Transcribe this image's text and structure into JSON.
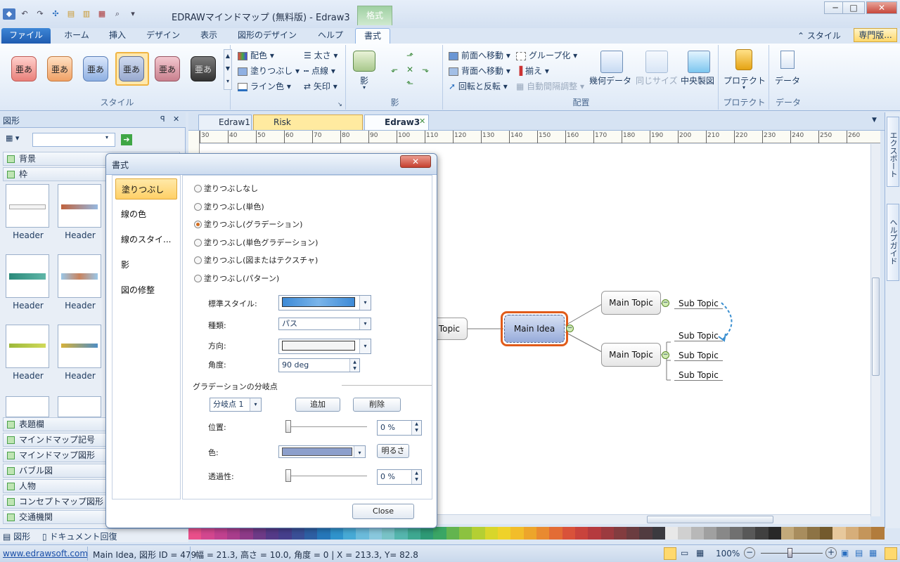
{
  "window": {
    "title": "EDRAWマインドマップ (無料版) - Edraw3",
    "context_tab": "格式",
    "min": "─",
    "max": "□",
    "close": "✕"
  },
  "tabs": [
    "ファイル",
    "ホーム",
    "挿入",
    "デザイン",
    "表示",
    "図形のデザイン",
    "ヘルプ",
    "書式"
  ],
  "ribbon_right": {
    "style": "スタイル",
    "pro": "専門版..."
  },
  "ribbon": {
    "style_swatch": "亜あ",
    "style_group": "スタイル",
    "color_scheme": "配色",
    "fill": "塗りつぶし",
    "line_color": "ライン色",
    "thickness": "太さ",
    "dotted": "点線",
    "arrow": "矢印",
    "shadow_btn": "影",
    "shadow_group": "影",
    "bring_front": "前面へ移動",
    "send_back": "背面へ移動",
    "rotate_flip": "回転と反転",
    "group": "グループ化",
    "align": "揃え",
    "auto_space": "自動間隔調整",
    "geometry": "幾何データ",
    "same_size": "同じサイズ",
    "center": "中央製図",
    "arrange_group": "配置",
    "protect": "プロテクト",
    "protect_group": "プロテクト",
    "data": "データ",
    "data_group": "データ"
  },
  "shapes_panel": {
    "title": "図形",
    "pin": "ꟼ",
    "close": "✕",
    "categories_top": [
      "背景",
      "枠"
    ],
    "thumb_label": "Header",
    "categories_bottom": [
      "表題欄",
      "マインドマップ記号",
      "マインドマップ図形",
      "バブル図",
      "人物",
      "コンセプトマップ図形",
      "交通機関"
    ],
    "bottom_tabs": [
      "図形",
      "ドキュメント回復"
    ]
  },
  "doc_tabs": [
    "Edraw1",
    "Risk Management.edx",
    "Edraw3"
  ],
  "ruler_ticks": [
    "30",
    "40",
    "50",
    "60",
    "70",
    "80",
    "90",
    "100",
    "110",
    "120",
    "130",
    "140",
    "150",
    "160",
    "170",
    "180",
    "190",
    "200",
    "210",
    "220",
    "230",
    "240",
    "250",
    "260"
  ],
  "mindmap": {
    "main_idea": "Main Idea",
    "left_topic": "Topic",
    "topic1": "Main Topic",
    "topic2": "Main Topic",
    "sub1": "Sub Topic",
    "sub2": "Sub Topic",
    "sub3": "Sub Topic",
    "sub4": "Sub Topic"
  },
  "right_tabs": [
    "エクスポート",
    "ヘルプガイド"
  ],
  "dialog": {
    "title": "書式",
    "close": "✕",
    "nav": [
      "塗りつぶし",
      "線の色",
      "線のスタイ...",
      "影",
      "図の修整"
    ],
    "radios": [
      "塗りつぶしなし",
      "塗りつぶし(単色)",
      "塗りつぶし(グラデーション)",
      "塗りつぶし(単色グラデーション)",
      "塗りつぶし(図またはテクスチャ)",
      "塗りつぶし(パターン)"
    ],
    "selected_radio": 2,
    "std_style_label": "標準スタイル:",
    "type_label": "種類:",
    "type_value": "パス",
    "direction_label": "方向:",
    "angle_label": "角度:",
    "angle_value": "90 deg",
    "stops_header": "グラデーションの分岐点",
    "stop_value": "分岐点 1",
    "add": "追加",
    "delete": "削除",
    "position_label": "位置:",
    "position_value": "0 %",
    "color_label": "色:",
    "brightness": "明るさ",
    "transparency_label": "透過性:",
    "transparency_value": "0 %",
    "close_button": "Close",
    "position_fraction": 0,
    "transparency_fraction": 0
  },
  "status": {
    "website": "www.edrawsoft.com",
    "shape_info": "Main Idea, 図形 ID = 479",
    "geometry": "幅 = 21.3, 高さ = 10.0, 角度 = 0 | X = 213.3, Y= 82.8",
    "zoom": "100%"
  },
  "palette": [
    "#e94f8a",
    "#d3478f",
    "#c1418f",
    "#a93d8c",
    "#8e3a88",
    "#6e3a87",
    "#553a88",
    "#463f8c",
    "#3a4f97",
    "#2e5fa3",
    "#2677b9",
    "#2f93cc",
    "#47aad6",
    "#6bbbdb",
    "#89c8dd",
    "#79c3c7",
    "#55b6ae",
    "#3ea891",
    "#2e9a76",
    "#3aa665",
    "#63b44f",
    "#8cc240",
    "#b4cf33",
    "#d8d62b",
    "#efd22a",
    "#f2bd2a",
    "#eda52b",
    "#e98a30",
    "#e36c35",
    "#d9523a",
    "#c9433c",
    "#b53a3e",
    "#9c3a3f",
    "#833c3f",
    "#6b3c40",
    "#513b40",
    "#3b3a3f",
    "#e8e8e8",
    "#d0d0d0",
    "#b8b8b8",
    "#a0a0a0",
    "#888888",
    "#707070",
    "#585858",
    "#404040",
    "#282828",
    "#c2a97a",
    "#a88d5e",
    "#8d7345",
    "#735a2d",
    "#e7c89c",
    "#d6ae7a",
    "#c4955a",
    "#b27c3c"
  ],
  "colors": {
    "accent": "#f08c1e",
    "main_idea_border": "#e05b1a",
    "main_idea_fill": "#a7b9df"
  }
}
